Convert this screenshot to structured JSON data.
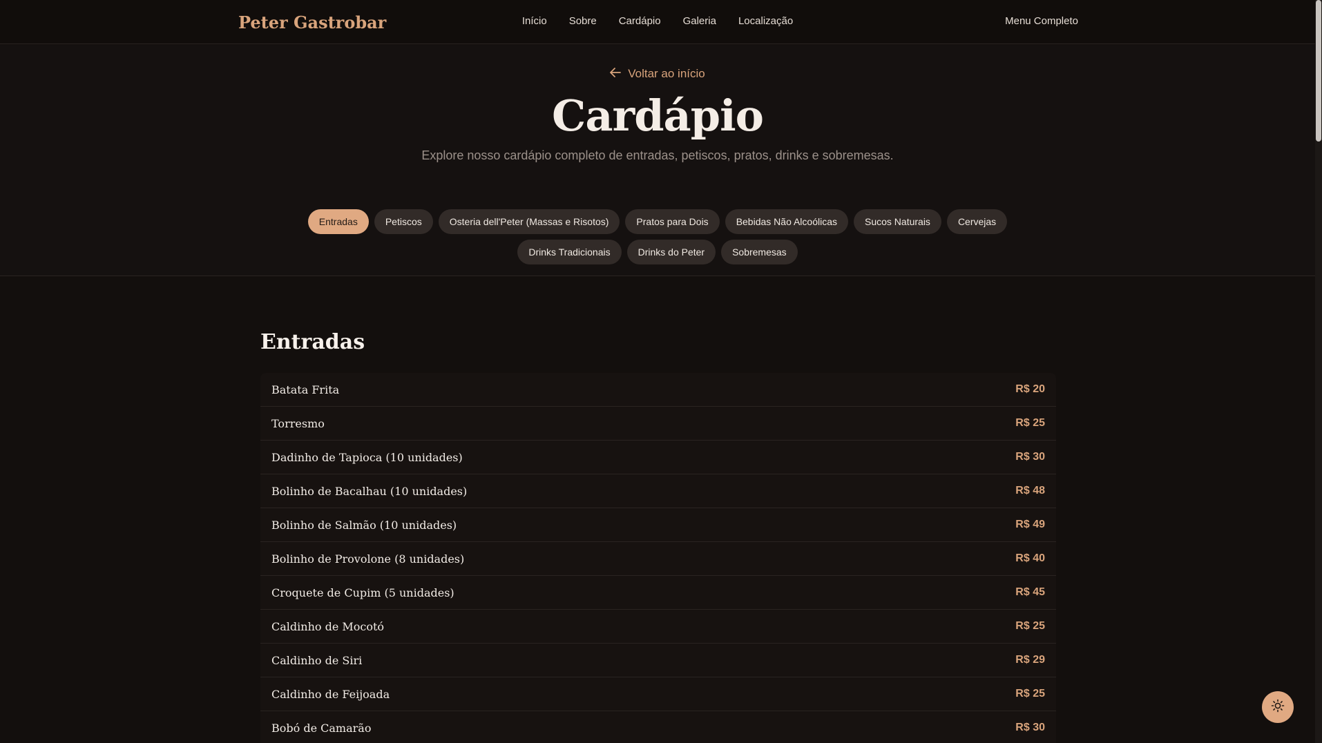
{
  "header": {
    "brand": "Peter Gastrobar",
    "nav": [
      "Início",
      "Sobre",
      "Cardápio",
      "Galeria",
      "Localização"
    ],
    "menu_completo": "Menu Completo"
  },
  "hero": {
    "back_label": "Voltar ao início",
    "title": "Cardápio",
    "subtitle": "Explore nosso cardápio completo de entradas, petiscos, pratos, drinks e sobremesas."
  },
  "tabs": [
    {
      "label": "Entradas",
      "active": true
    },
    {
      "label": "Petiscos"
    },
    {
      "label": "Osteria dell'Peter (Massas e Risotos)"
    },
    {
      "label": "Pratos para Dois"
    },
    {
      "label": "Bebidas Não Alcoólicas"
    },
    {
      "label": "Sucos Naturais"
    },
    {
      "label": "Cervejas"
    },
    {
      "label": "Drinks Tradicionais"
    },
    {
      "label": "Drinks do Peter"
    },
    {
      "label": "Sobremesas"
    }
  ],
  "section": {
    "title": "Entradas",
    "items": [
      {
        "name": "Batata Frita",
        "price": "R$ 20"
      },
      {
        "name": "Torresmo",
        "price": "R$ 25"
      },
      {
        "name": "Dadinho de Tapioca (10 unidades)",
        "price": "R$ 30"
      },
      {
        "name": "Bolinho de Bacalhau (10 unidades)",
        "price": "R$ 48"
      },
      {
        "name": "Bolinho de Salmão (10 unidades)",
        "price": "R$ 49"
      },
      {
        "name": "Bolinho de Provolone (8 unidades)",
        "price": "R$ 40"
      },
      {
        "name": "Croquete de Cupim (5 unidades)",
        "price": "R$ 45"
      },
      {
        "name": "Caldinho de Mocotó",
        "price": "R$ 25"
      },
      {
        "name": "Caldinho de Siri",
        "price": "R$ 29"
      },
      {
        "name": "Caldinho de Feijoada",
        "price": "R$ 25"
      },
      {
        "name": "Bobó de Camarão",
        "price": "R$ 30"
      }
    ]
  },
  "icons": {
    "back": "arrow-left-icon",
    "theme": "sun-icon"
  },
  "colors": {
    "accent": "#d9a47c",
    "background": "#130f0d"
  }
}
